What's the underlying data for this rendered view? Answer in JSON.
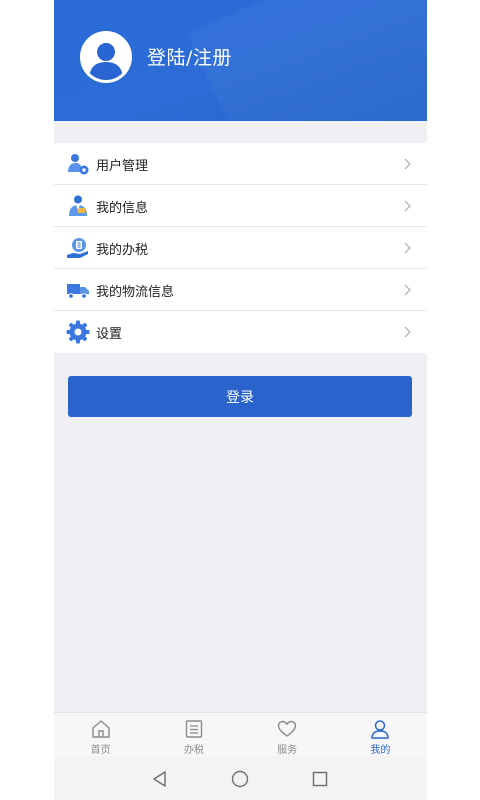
{
  "header": {
    "login_title": "登陆/注册",
    "avatar_icon": "user-avatar-icon",
    "background_color": "#2a6ad8"
  },
  "menu": {
    "items": [
      {
        "label": "用户管理",
        "icon": "user-gear-icon"
      },
      {
        "label": "我的信息",
        "icon": "person-info-icon"
      },
      {
        "label": "我的办税",
        "icon": "tax-hand-icon"
      },
      {
        "label": "我的物流信息",
        "icon": "truck-icon"
      },
      {
        "label": "设置",
        "icon": "gear-icon"
      }
    ],
    "chevron_icon": "chevron-right-icon"
  },
  "login_button": {
    "label": "登录",
    "color": "#2a63cc"
  },
  "tabbar": {
    "tabs": [
      {
        "label": "首页",
        "icon": "home-icon",
        "active": false
      },
      {
        "label": "办税",
        "icon": "list-icon",
        "active": false
      },
      {
        "label": "服务",
        "icon": "heart-icon",
        "active": false
      },
      {
        "label": "我的",
        "icon": "person-icon",
        "active": true
      }
    ],
    "active_color": "#2a67cc"
  },
  "system_nav": {
    "back_icon": "back-triangle-icon",
    "home_icon": "home-circle-icon",
    "recents_icon": "recents-square-icon"
  }
}
